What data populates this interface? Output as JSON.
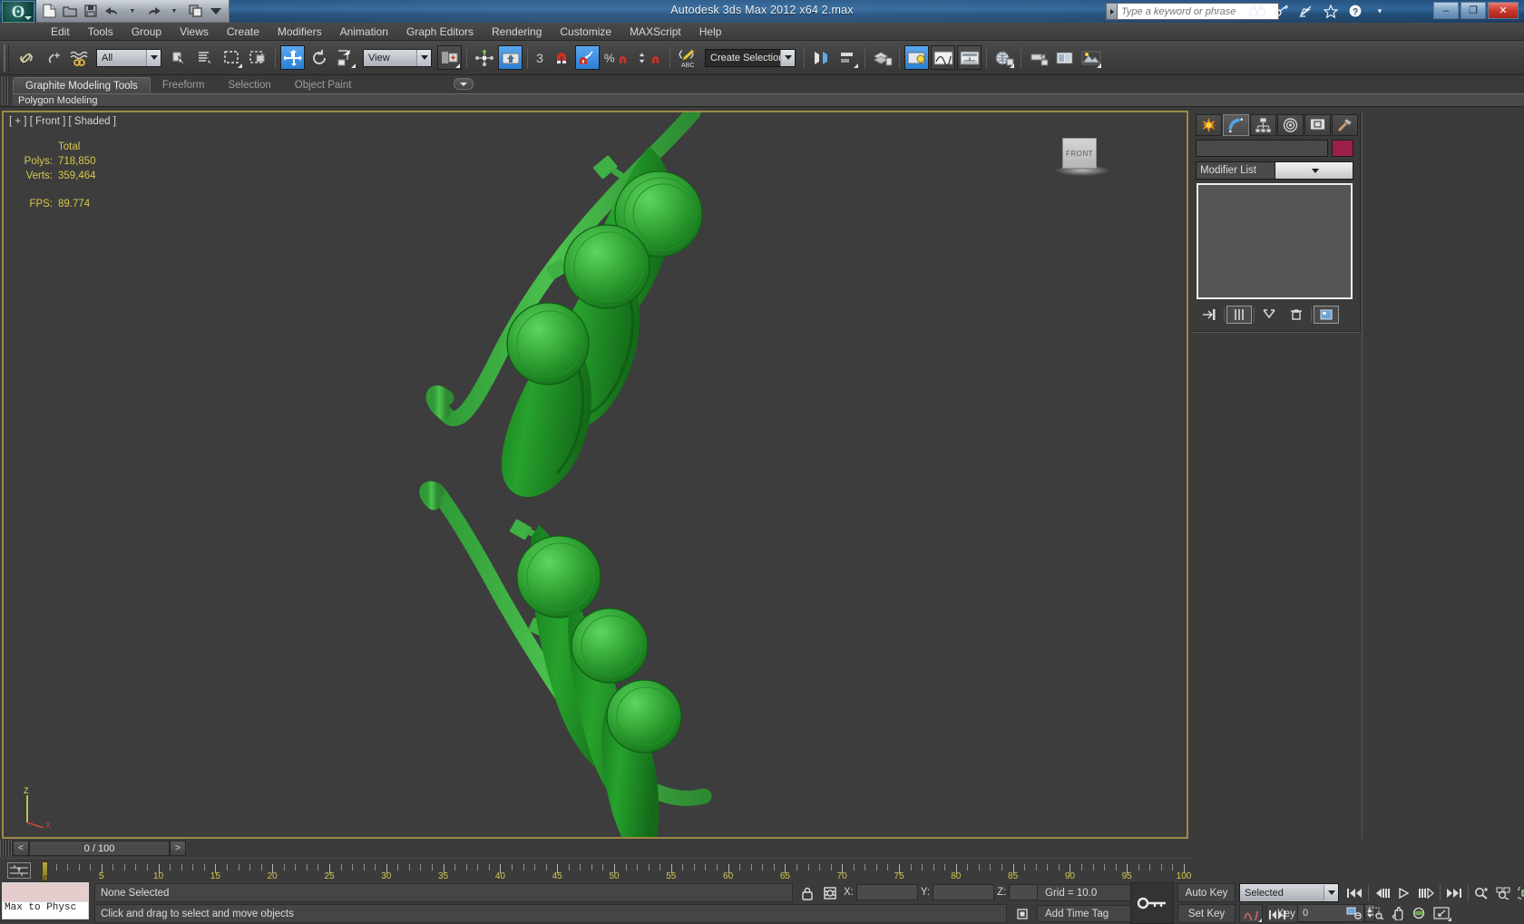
{
  "window": {
    "title": "Autodesk 3ds Max  2012 x64     2.max",
    "app_icon": "3dsmax-logo-icon",
    "minimize_label": "–",
    "restore_label": "❐",
    "close_label": "✕"
  },
  "quick_access": [
    {
      "name": "new-file-icon",
      "glyph": "🗋"
    },
    {
      "name": "open-file-icon",
      "glyph": "🗁"
    },
    {
      "name": "save-file-icon",
      "glyph": "💾"
    },
    {
      "name": "undo-icon",
      "glyph": "↶"
    },
    {
      "name": "undo-dropdown-icon",
      "glyph": "▾"
    },
    {
      "name": "redo-icon",
      "glyph": "↷"
    },
    {
      "name": "redo-dropdown-icon",
      "glyph": "▾"
    },
    {
      "name": "project-folder-icon",
      "glyph": "🗐"
    },
    {
      "name": "qat-customize-icon",
      "glyph": "▾"
    }
  ],
  "search": {
    "placeholder": "Type a keyword or phrase",
    "dropdown_icon": "chevron-right-icon"
  },
  "header_icons": [
    {
      "name": "binoculars-icon",
      "glyph": "👓"
    },
    {
      "name": "key-icon",
      "glyph": "🔑"
    },
    {
      "name": "satellite-dish-icon",
      "glyph": "📡"
    },
    {
      "name": "favorites-star-icon",
      "glyph": "★"
    },
    {
      "name": "help-icon",
      "glyph": "?"
    },
    {
      "name": "help-dropdown-icon",
      "glyph": "▾"
    }
  ],
  "menu": {
    "items": [
      "Edit",
      "Tools",
      "Group",
      "Views",
      "Create",
      "Modifiers",
      "Animation",
      "Graph Editors",
      "Rendering",
      "Customize",
      "MAXScript",
      "Help"
    ]
  },
  "main_toolbar": {
    "select_filter": {
      "value": "All"
    },
    "reference_coord": {
      "value": "View"
    },
    "selection_set": {
      "value": "Create Selection Se",
      "placeholder": "Create Selection Set"
    },
    "angle_snap_value": "3",
    "buttons": [
      {
        "name": "select-and-link-icon",
        "glyph": "🔗",
        "state": "off"
      },
      {
        "name": "unlink-selection-icon",
        "glyph": "⛓",
        "state": "off"
      },
      {
        "name": "bind-to-space-warp-icon",
        "glyph": "≈",
        "state": "off"
      },
      {
        "name": "select-object-icon",
        "glyph": "⬚",
        "state": "off"
      },
      {
        "name": "select-by-name-icon",
        "glyph": "☰",
        "state": "off"
      },
      {
        "name": "rectangular-selection-region-icon",
        "glyph": "▭",
        "state": "off"
      },
      {
        "name": "window-crossing-icon",
        "glyph": "❏",
        "state": "off"
      },
      {
        "name": "select-and-move-icon",
        "glyph": "✥",
        "state": "on"
      },
      {
        "name": "select-and-rotate-icon",
        "glyph": "⟳",
        "state": "off"
      },
      {
        "name": "select-and-uniform-scale-icon",
        "glyph": "◹",
        "state": "off"
      },
      {
        "name": "use-pivot-point-center-icon",
        "glyph": "▣",
        "state": "off"
      },
      {
        "name": "use-selection-center-icon",
        "glyph": "✛",
        "state": "off"
      },
      {
        "name": "mirror-icon",
        "glyph": "⬆",
        "state": "on"
      },
      {
        "name": "angle-snap-toggle-icon",
        "glyph": "∠",
        "state": "on"
      },
      {
        "name": "snaps-toggle-icon",
        "glyph": "⊓",
        "state": "off"
      },
      {
        "name": "percent-snap-toggle-icon",
        "glyph": "%",
        "state": "off"
      },
      {
        "name": "spinner-snap-toggle-icon",
        "glyph": "⇕",
        "state": "off"
      },
      {
        "name": "named-selection-icon",
        "glyph": "✎",
        "state": "off"
      },
      {
        "name": "mirror-tool-icon",
        "glyph": "◐",
        "state": "off"
      },
      {
        "name": "align-icon",
        "glyph": "⊟",
        "state": "off"
      },
      {
        "name": "layer-manager-icon",
        "glyph": "▤",
        "state": "off"
      },
      {
        "name": "scene-explorer-icon",
        "glyph": "💡",
        "state": "on"
      },
      {
        "name": "curve-editor-icon",
        "glyph": "〜",
        "state": "off"
      },
      {
        "name": "schematic-view-icon",
        "glyph": "⊞",
        "state": "off"
      },
      {
        "name": "material-editor-icon",
        "glyph": "◉",
        "state": "off"
      },
      {
        "name": "render-setup-icon",
        "glyph": "🫖",
        "state": "off"
      },
      {
        "name": "rendered-frame-window-icon",
        "glyph": "▦",
        "state": "off"
      },
      {
        "name": "render-production-icon",
        "glyph": "🖼",
        "state": "off"
      }
    ]
  },
  "ribbon": {
    "tabs": [
      {
        "label": "Graphite Modeling Tools",
        "active": true
      },
      {
        "label": "Freeform",
        "active": false
      },
      {
        "label": "Selection",
        "active": false
      },
      {
        "label": "Object Paint",
        "active": false
      }
    ],
    "overflow_icon": "chevron-down-icon",
    "panel_label": "Polygon Modeling"
  },
  "viewport": {
    "label": "[ + ] [ Front ] [ Shaded ]",
    "stats": {
      "header": "Total",
      "rows": [
        {
          "label": "Polys:",
          "value": "718,850"
        },
        {
          "label": "Verts:",
          "value": "359,464"
        }
      ],
      "fps_label": "FPS:",
      "fps_value": "89.774"
    },
    "view_cube_label": "FRONT",
    "axis_labels": {
      "z": "Z",
      "x": "X"
    },
    "border_color": "#9d8a46",
    "background_color": "#3d3d3d",
    "model_color": "#2e9b33",
    "model_name": "pea-pod-model"
  },
  "command_panel": {
    "tabs": [
      {
        "name": "create-tab",
        "glyph": "✸",
        "selected": false
      },
      {
        "name": "modify-tab",
        "glyph": "◝",
        "selected": true
      },
      {
        "name": "hierarchy-tab",
        "glyph": "⛛",
        "selected": false
      },
      {
        "name": "motion-tab",
        "glyph": "◎",
        "selected": false
      },
      {
        "name": "display-tab",
        "glyph": "🖵",
        "selected": false
      },
      {
        "name": "utilities-tab",
        "glyph": "🔨",
        "selected": false
      }
    ],
    "object_name": "",
    "object_color": "#9e1f4a",
    "modifier_list_label": "Modifier List",
    "stack_items": [],
    "stack_buttons": [
      {
        "name": "pin-stack-icon",
        "glyph": "⇥"
      },
      {
        "name": "show-end-result-icon",
        "glyph": "⫼"
      },
      {
        "name": "make-unique-icon",
        "glyph": "⋎"
      },
      {
        "name": "remove-modifier-icon",
        "glyph": "🗑"
      },
      {
        "name": "configure-modifier-sets-icon",
        "glyph": "▣"
      }
    ]
  },
  "time_slider": {
    "prev_label": "<",
    "next_label": ">",
    "current": "0 / 100"
  },
  "track_bar": {
    "open_mini_curve_editor_icon": "mini-curve-editor-icon",
    "start": 0,
    "end": 100,
    "tick_labels": [
      5,
      10,
      15,
      20,
      25,
      30,
      35,
      40,
      45,
      50,
      55,
      60,
      65,
      70,
      75,
      80,
      85,
      90,
      95,
      100
    ],
    "playhead_label": "0"
  },
  "status_bar": {
    "mtp_label": "Max to Physc",
    "mtp_swatch_color": "#e5cdcd",
    "selection_status": "None Selected",
    "prompt": "Click and drag to select and move objects",
    "lock_icon": "lock-selection-icon",
    "selection_center_icon": "selection-lock-icon",
    "coords": [
      {
        "label": "X:",
        "value": ""
      },
      {
        "label": "Y:",
        "value": ""
      },
      {
        "label": "Z:",
        "value": ""
      }
    ],
    "grid_text": "Grid = 10.0",
    "add_time_tag": "Add Time Tag",
    "time_tag_icon": "time-tag-icon"
  },
  "animation_bar": {
    "key_mode_icon": "set-key-mode-icon",
    "auto_key_label": "Auto Key",
    "set_key_label": "Set Key",
    "selection_filter": "Selected",
    "key_filters_label": "Key Filters...",
    "animation_curve_icon": "param-curve-icon",
    "frame_value": "0",
    "playback_buttons": [
      {
        "name": "go-to-start-icon",
        "glyph": "|◁◁"
      },
      {
        "name": "previous-frame-icon",
        "glyph": "◁|||"
      },
      {
        "name": "play-animation-icon",
        "glyph": "▷"
      },
      {
        "name": "next-frame-icon",
        "glyph": "|||▷"
      },
      {
        "name": "go-to-end-icon",
        "glyph": "▷▷|"
      },
      {
        "name": "key-mode-toggle-icon",
        "glyph": "|◁▷|"
      }
    ],
    "viewport_nav": [
      {
        "name": "zoom-icon",
        "glyph": "🔍"
      },
      {
        "name": "zoom-all-icon",
        "glyph": "🔎"
      },
      {
        "name": "zoom-extents-icon",
        "glyph": "⬔"
      },
      {
        "name": "zoom-extents-all-icon",
        "glyph": "▩"
      },
      {
        "name": "field-of-view-icon",
        "glyph": "◱"
      },
      {
        "name": "zoom-region-icon",
        "glyph": "⬚"
      },
      {
        "name": "pan-view-icon",
        "glyph": "✋"
      },
      {
        "name": "orbit-icon",
        "glyph": "◓"
      },
      {
        "name": "maximize-viewport-toggle-icon",
        "glyph": "⤡"
      }
    ]
  }
}
